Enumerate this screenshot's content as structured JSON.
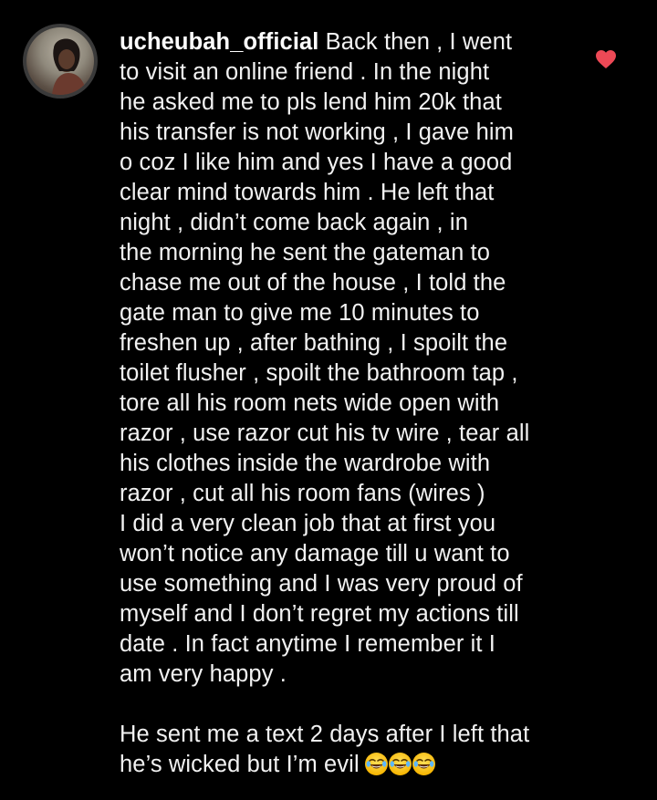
{
  "comment": {
    "username": "ucheubah_official",
    "first_line_rest": " Back then , I went",
    "lines": [
      "to visit an online friend . In the night",
      "he asked me to pls lend him 20k that",
      "his transfer is not working , I gave him",
      "o coz I like him and yes I have a good",
      "clear mind towards him . He left that",
      "night , didn’t come back again , in",
      "the morning he sent the gateman to",
      "chase me out of the house , I told the",
      "gate man to give me 10 minutes to",
      "freshen up , after bathing , I spoilt the",
      "toilet flusher , spoilt the bathroom tap ,",
      "tore all his room nets wide open with",
      "razor , use razor cut his tv wire , tear all",
      "his clothes inside the wardrobe with",
      "razor , cut all his room fans (wires )",
      "I did a very clean job that at first you",
      "won’t notice any damage till u want to",
      "use something and I was very proud of",
      "myself and I don’t regret my actions till",
      "date . In fact anytime I remember it I",
      "am very happy ."
    ],
    "second_paragraph": [
      "He sent me a text 2 days after I left that",
      "he’s wicked but I’m evil"
    ],
    "emojis": [
      "face-with-tears-of-joy-icon",
      "face-with-tears-of-joy-icon",
      "face-with-tears-of-joy-icon"
    ],
    "like_state": "liked"
  },
  "colors": {
    "background": "#000000",
    "text": "#f2f2f2",
    "heart": "#ed4956"
  }
}
